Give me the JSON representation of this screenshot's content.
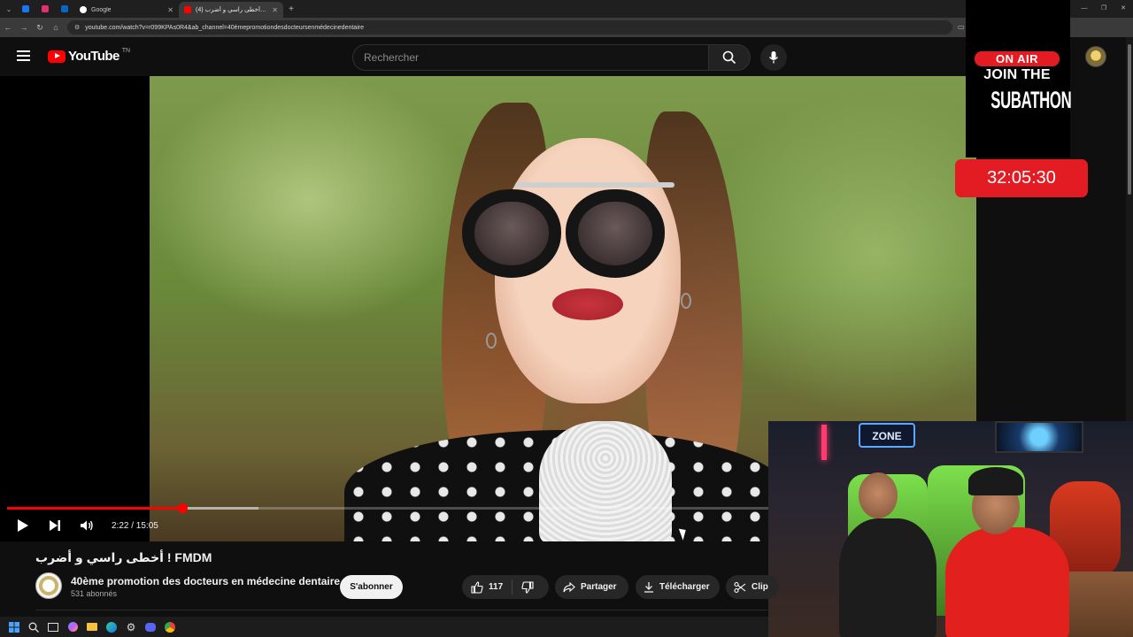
{
  "browser": {
    "tabs": [
      {
        "title": "",
        "favicon_color": "#1877f2",
        "active": false,
        "pinned": true
      },
      {
        "title": "",
        "favicon_color": "#e1306c",
        "active": false,
        "pinned": true
      },
      {
        "title": "",
        "favicon_color": "#0a66c2",
        "active": false,
        "pinned": true
      },
      {
        "title": "Google",
        "favicon_color": "#ffffff",
        "active": false,
        "pinned": false
      },
      {
        "title": "(4) أخطى راسي و أضرب ! FMDM - YouTube",
        "favicon_color": "#ff0000",
        "active": true,
        "pinned": false
      }
    ],
    "url": "youtube.com/watch?v=r099KPAs0R4&ab_channel=40èmepromotiondesdocteursenmédecinedentaire"
  },
  "header": {
    "logo_text": "YouTube",
    "logo_region": "TN",
    "search_placeholder": "Rechercher"
  },
  "player": {
    "current_time": "2:22",
    "duration": "15:05",
    "time_display": "2:22 / 15:05",
    "progress_fraction": 0.23,
    "buffered_fraction": 0.33
  },
  "overlay": {
    "on_air": "ON AIR",
    "join": "JOIN THE",
    "subathon": "SUBATHON",
    "timer": "32:05:30",
    "accent": "#e31b23",
    "webcam_sign": "ZONE"
  },
  "video": {
    "title": "أخطى راسي و أضرب ! FMDM",
    "channel_name": "40ème promotion des docteurs en médecine dentaire",
    "subscribers": "531 abonnés",
    "subscribe_label": "S'abonner",
    "likes": "117",
    "share_label": "Partager",
    "download_label": "Télécharger",
    "clip_label": "Clip"
  }
}
